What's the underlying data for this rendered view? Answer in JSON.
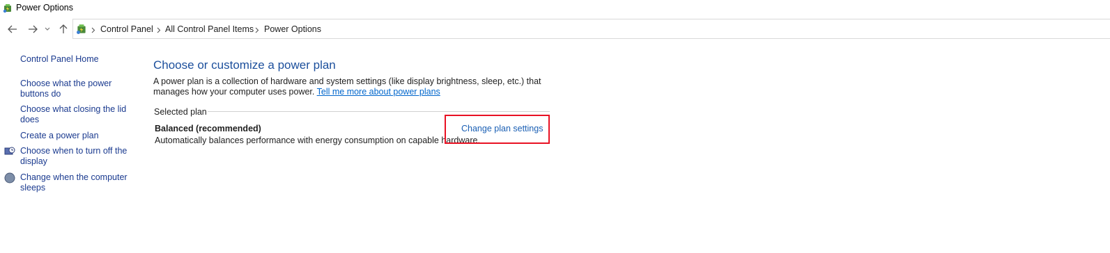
{
  "window": {
    "title": "Power Options",
    "icon": "power-options-icon"
  },
  "nav": {
    "back_icon": "back-arrow-icon",
    "forward_icon": "forward-arrow-icon",
    "recent_icon": "chevron-down-icon",
    "up_icon": "up-arrow-icon"
  },
  "breadcrumb": {
    "items": [
      "Control Panel",
      "All Control Panel Items",
      "Power Options"
    ]
  },
  "sidebar": {
    "home": "Control Panel Home",
    "links": [
      {
        "label": "Choose what the power buttons do"
      },
      {
        "label": "Choose what closing the lid does"
      },
      {
        "label": "Create a power plan"
      },
      {
        "label": "Choose when to turn off the display",
        "icon": "display-timer-icon"
      },
      {
        "label": "Change when the computer sleeps",
        "icon": "sleep-moon-icon"
      }
    ]
  },
  "main": {
    "title": "Choose or customize a power plan",
    "description": "A power plan is a collection of hardware and system settings (like display brightness, sleep, etc.) that manages how your computer uses power.",
    "learn_more_link": "Tell me more about power plans",
    "selected_plan_label": "Selected plan",
    "plan": {
      "name": "Balanced (recommended)",
      "description": "Automatically balances performance with energy consumption on capable hardware.",
      "change_link": "Change plan settings"
    }
  },
  "colors": {
    "link": "#1a5fb4",
    "title": "#1c4f9c",
    "highlight": "#e81123"
  }
}
